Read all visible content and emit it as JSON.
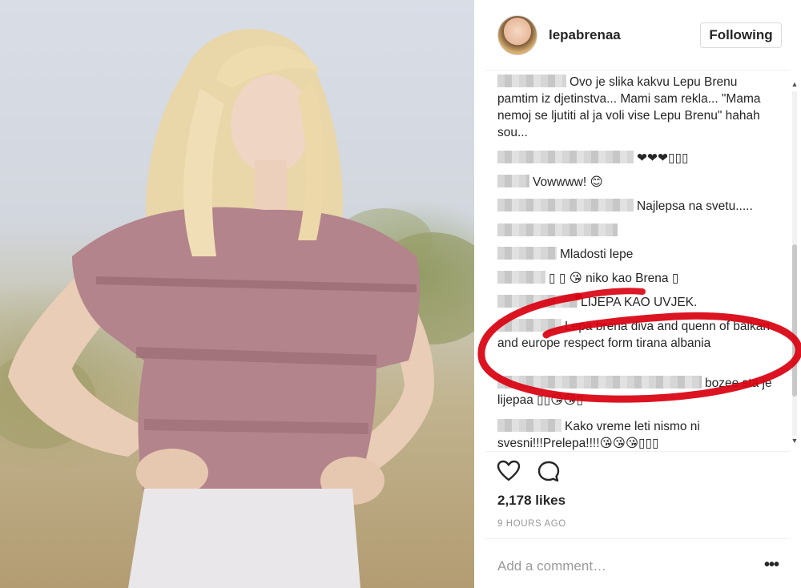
{
  "post": {
    "username": "lepabrenaa",
    "follow_label": "Following",
    "likes": "2,178 likes",
    "time": "9 HOURS AGO",
    "add_comment_placeholder": "Add a comment…",
    "more_label": "•••"
  },
  "comments": [
    {
      "text": "Ovo je slika kakvu Lepu Brenu pamtim iz djetinstva... Mami sam rekla... \"Mama nemoj se ljutiti al ja voli vise Lepu Brenu\" hahah sou..."
    },
    {
      "text": "❤❤❤▯▯▯"
    },
    {
      "text": "Vowwww! 😊"
    },
    {
      "text": "Najlepsa na svetu....."
    },
    {
      "text": "Mladosti lepe"
    },
    {
      "text": "▯ ▯ 😘 niko kao Brena ▯"
    },
    {
      "text": "LIJEPA KAO UVJEK."
    },
    {
      "text": "Lepa brena diva and quenn of balkan and europe respect form tirana albania"
    },
    {
      "text": "bozee sta je lijepaa ▯▯😘😘▯"
    },
    {
      "text": "Kako vreme leti nismo ni svesni!!!Prelepa!!!!😘😘😘▯▯▯"
    }
  ],
  "icons": {
    "like": "heart-icon",
    "comment": "comment-bubble-icon",
    "scroll_up": "▲",
    "scroll_down": "▼"
  },
  "colors": {
    "annotation_red": "#d9000f",
    "follow_border": "#dbdbdb",
    "muted_text": "#999999"
  }
}
